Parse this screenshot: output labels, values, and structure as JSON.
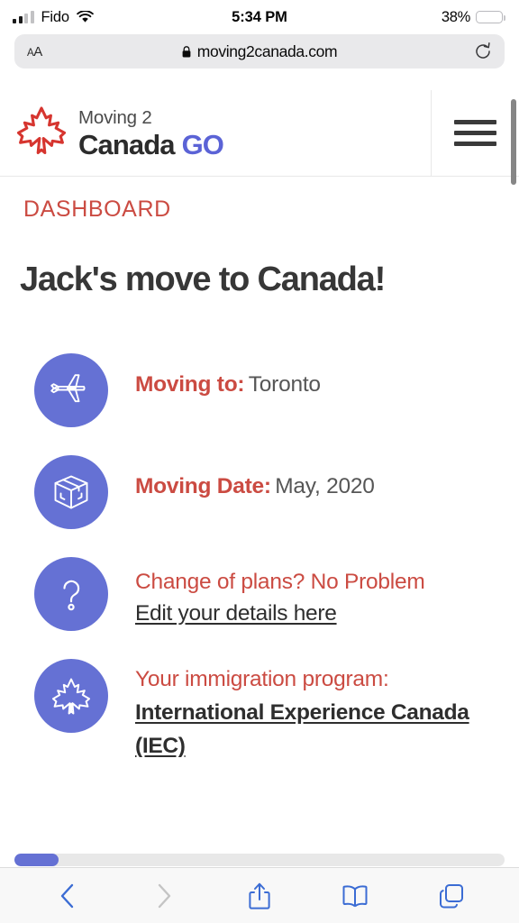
{
  "status_bar": {
    "carrier": "Fido",
    "time": "5:34 PM",
    "battery_percent": "38%",
    "battery_fill_color": "#f5c33b",
    "signal_bars_active": 2,
    "signal_bars_total": 4,
    "wifi_icon": "wifi-icon"
  },
  "address_bar": {
    "text_size_label": "A",
    "text_size_label_small": "A",
    "lock_icon": "lock-icon",
    "url": "moving2canada.com",
    "reload_icon": "reload-icon"
  },
  "site_header": {
    "logo": {
      "leaf_icon": "maple-leaf-icon",
      "line1": "Moving 2",
      "line2_dark": "Canada",
      "line2_accent": "GO",
      "accent_color": "#5b63d6"
    },
    "menu_icon": "hamburger-menu-icon"
  },
  "page": {
    "breadcrumb": "DASHBOARD",
    "title": "Jack's move to Canada!",
    "accent_red": "#cb4b42",
    "bubble_color": "#6571d4",
    "items": [
      {
        "icon": "airplane-icon",
        "label": "Moving to:",
        "value": "Toronto",
        "layout": "inline"
      },
      {
        "icon": "moving-box-icon",
        "label": "Moving Date:",
        "value": "May, 2020",
        "layout": "inline"
      },
      {
        "icon": "question-mark-icon",
        "label": "Change of plans? No Problem",
        "link": "Edit your details here",
        "layout": "stacked"
      },
      {
        "icon": "maple-leaf-icon",
        "label": "Your immigration program:",
        "link": "International Experience Canada (IEC)",
        "layout": "stacked-bold"
      }
    ]
  },
  "load_progress": {
    "percent": 9,
    "color": "#6571d4"
  },
  "toolbar": {
    "back_icon": "back-chevron-icon",
    "forward_icon": "forward-chevron-icon",
    "share_icon": "share-icon",
    "bookmarks_icon": "bookmarks-book-icon",
    "tabs_icon": "tabs-icon",
    "active_color": "#3b6cd4",
    "disabled_color": "#c4c4c4"
  }
}
